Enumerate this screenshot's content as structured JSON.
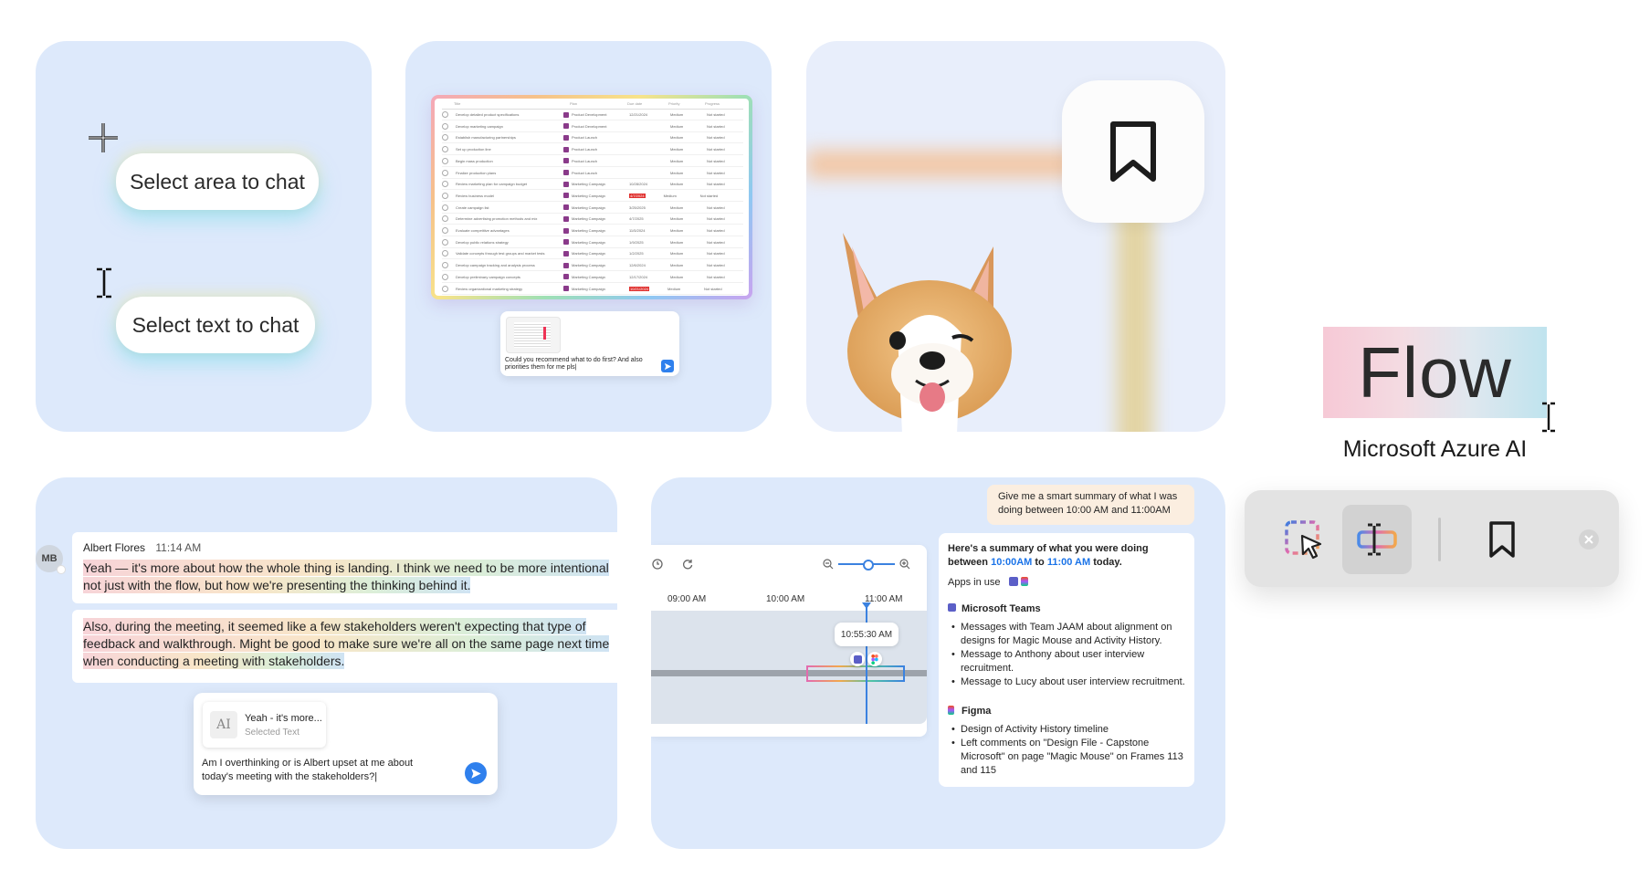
{
  "card1": {
    "area_button": "Select area to chat",
    "text_button": "Select text to chat"
  },
  "card2": {
    "headers": [
      "Title",
      "Plan",
      "Due date",
      "Priority",
      "Progress"
    ],
    "rows": [
      {
        "title": "Develop detailed product specifications",
        "plan": "Product Development",
        "due": "12/21/2024",
        "late": false
      },
      {
        "title": "Develop marketing campaign",
        "plan": "Product Development",
        "due": "",
        "late": false
      },
      {
        "title": "Establish manufacturing partnerships",
        "plan": "Product Launch",
        "due": "",
        "late": false
      },
      {
        "title": "Set up production line",
        "plan": "Product Launch",
        "due": "",
        "late": false
      },
      {
        "title": "Begin mass production",
        "plan": "Product Launch",
        "due": "",
        "late": false
      },
      {
        "title": "Finalize production plans",
        "plan": "Product Launch",
        "due": "",
        "late": false
      },
      {
        "title": "Review marketing plan for campaign budget",
        "plan": "Marketing Campaign",
        "due": "10/28/2024",
        "late": false
      },
      {
        "title": "Review business model",
        "plan": "Marketing Campaign",
        "due": "4/7/2024",
        "late": true
      },
      {
        "title": "Create campaign list",
        "plan": "Marketing Campaign",
        "due": "3/25/2025",
        "late": false
      },
      {
        "title": "Determine advertising promotion methods and mix",
        "plan": "Marketing Campaign",
        "due": "4/7/2025",
        "late": false
      },
      {
        "title": "Evaluate competitive advantages",
        "plan": "Marketing Campaign",
        "due": "11/5/2024",
        "late": false
      },
      {
        "title": "Develop public relations strategy",
        "plan": "Marketing Campaign",
        "due": "1/9/2025",
        "late": false
      },
      {
        "title": "Validate concepts through test groups and market tests",
        "plan": "Marketing Campaign",
        "due": "1/2/2025",
        "late": false
      },
      {
        "title": "Develop campaign tracking and analysis process",
        "plan": "Marketing Campaign",
        "due": "12/6/2024",
        "late": false
      },
      {
        "title": "Develop preliminary campaign concepts",
        "plan": "Marketing Campaign",
        "due": "12/17/2024",
        "late": false
      },
      {
        "title": "Review organizational marketing strategy",
        "plan": "Marketing Campaign",
        "due": "10/21/2024",
        "late": true
      }
    ],
    "priority": "Medium",
    "progress": "Not started",
    "prompt": "Could you recommend what to do first? And also priorities them for me pls|"
  },
  "logo": {
    "word": "Flow",
    "caption": "Microsoft Azure AI"
  },
  "card4": {
    "avatar": "MB",
    "author": "Albert Flores",
    "time": "11:14 AM",
    "msg1_line1": "Yeah — it's more about how the whole thing is landing. I think we need to be more intentional",
    "msg1_line2": "not just with the flow, but how we're presenting the thinking behind it.",
    "msg2_line1": "Also, during the meeting, it seemed like a few stakeholders weren't expecting that type of",
    "msg2_line2": "feedback and walkthrough. Might be good to make sure we're all on the same page next time",
    "msg2_line3": "when conducting a meeting with stakeholders.",
    "chip_icon": "AI",
    "chip_title": "Yeah - it's more...",
    "chip_sub": "Selected Text",
    "prompt": "Am I overthinking or is Albert upset at me about today's meeting with the stakeholders?|"
  },
  "card5": {
    "user_prompt": "Give me a smart summary of what I was doing between 10:00 AM and 11:00AM",
    "times": [
      "09:00 AM",
      "10:00 AM",
      "11:00 AM"
    ],
    "tooltip": "10:55:30 AM",
    "summary_pre": "Here's a summary of what you were doing",
    "summary_between": "between",
    "summary_from": "10:00AM",
    "summary_to_word": "to",
    "summary_to": "11:00 AM",
    "summary_today": "today.",
    "apps_label": "Apps in use",
    "teams_title": "Microsoft Teams",
    "teams_items": [
      "Messages with Team JAAM about alignment on designs for Magic Mouse and Activity History.",
      "Message to Anthony about user interview recruitment.",
      "Message to Lucy about user interview recruitment."
    ],
    "figma_title": "Figma",
    "figma_items": [
      "Design of Activity History timeline",
      "Left comments on \"Design File - Capstone Microsoft\" on page \"Magic Mouse\" on Frames 113 and 115"
    ]
  },
  "icons": [
    "crosshair-icon",
    "text-cursor-icon",
    "bookmark-icon",
    "select-area-icon",
    "select-text-icon",
    "close-icon",
    "send-icon",
    "zoom-out-icon",
    "zoom-in-icon",
    "refresh-icon",
    "teams-icon",
    "figma-icon"
  ],
  "colors": {
    "card_bg": "#dde9fb",
    "accent_blue": "#2f80ed",
    "link_blue": "#1a73e8",
    "prompt_bubble": "#fbeee0"
  }
}
